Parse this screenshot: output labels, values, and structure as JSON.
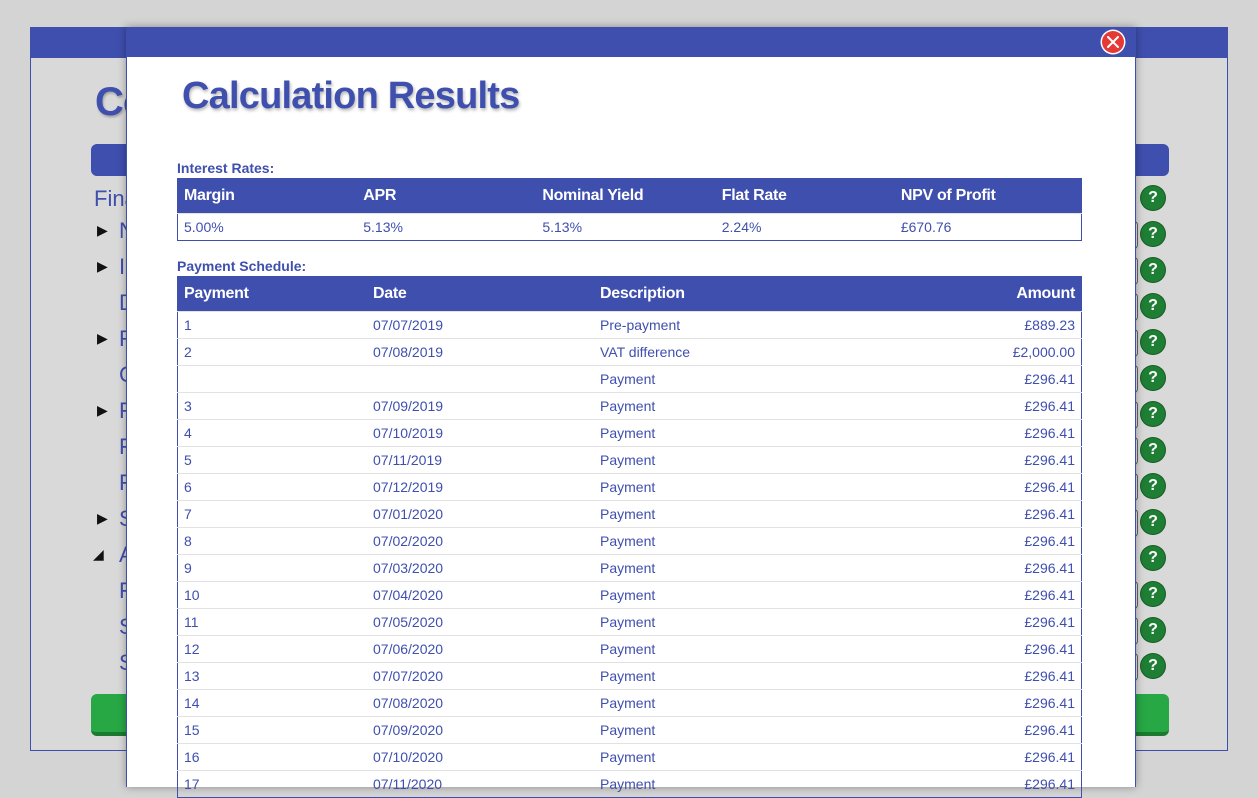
{
  "background_window": {
    "title_fragment": "Co",
    "section_fragment": "Fina",
    "rows": [
      {
        "kind": "expand",
        "text": "N"
      },
      {
        "kind": "expand",
        "text": "I"
      },
      {
        "kind": "plain",
        "text": "D"
      },
      {
        "kind": "expand",
        "text": "R"
      },
      {
        "kind": "plain",
        "text": "C"
      },
      {
        "kind": "expand",
        "text": "F"
      },
      {
        "kind": "plain",
        "text": "F"
      },
      {
        "kind": "plain",
        "text": "F"
      },
      {
        "kind": "expand",
        "text": "S"
      },
      {
        "kind": "collapse",
        "text": "A"
      },
      {
        "kind": "plain",
        "text": "F"
      },
      {
        "kind": "plain",
        "text": "S"
      },
      {
        "kind": "plain",
        "text": "S"
      }
    ],
    "help_label": "?"
  },
  "modal": {
    "title": "Calculation Results",
    "interest_rates_label": "Interest Rates:",
    "interest_rates": {
      "headers": [
        "Margin",
        "APR",
        "Nominal Yield",
        "Flat Rate",
        "NPV of Profit"
      ],
      "values": [
        "5.00%",
        "5.13%",
        "5.13%",
        "2.24%",
        "£670.76"
      ]
    },
    "payment_schedule_label": "Payment Schedule:",
    "payment_schedule": {
      "headers": [
        "Payment",
        "Date",
        "Description",
        "Amount"
      ],
      "rows": [
        [
          "1",
          "07/07/2019",
          "Pre-payment",
          "£889.23"
        ],
        [
          "2",
          "07/08/2019",
          "VAT difference",
          "£2,000.00"
        ],
        [
          "",
          "",
          "Payment",
          "£296.41"
        ],
        [
          "3",
          "07/09/2019",
          "Payment",
          "£296.41"
        ],
        [
          "4",
          "07/10/2019",
          "Payment",
          "£296.41"
        ],
        [
          "5",
          "07/11/2019",
          "Payment",
          "£296.41"
        ],
        [
          "6",
          "07/12/2019",
          "Payment",
          "£296.41"
        ],
        [
          "7",
          "07/01/2020",
          "Payment",
          "£296.41"
        ],
        [
          "8",
          "07/02/2020",
          "Payment",
          "£296.41"
        ],
        [
          "9",
          "07/03/2020",
          "Payment",
          "£296.41"
        ],
        [
          "10",
          "07/04/2020",
          "Payment",
          "£296.41"
        ],
        [
          "11",
          "07/05/2020",
          "Payment",
          "£296.41"
        ],
        [
          "12",
          "07/06/2020",
          "Payment",
          "£296.41"
        ],
        [
          "13",
          "07/07/2020",
          "Payment",
          "£296.41"
        ],
        [
          "14",
          "07/08/2020",
          "Payment",
          "£296.41"
        ],
        [
          "15",
          "07/09/2020",
          "Payment",
          "£296.41"
        ],
        [
          "16",
          "07/10/2020",
          "Payment",
          "£296.41"
        ],
        [
          "17",
          "07/11/2020",
          "Payment",
          "£296.41"
        ]
      ]
    }
  },
  "colors": {
    "primary": "#3f4fae",
    "close": "#e53935",
    "help": "#1e7e34",
    "action": "#28a745"
  }
}
